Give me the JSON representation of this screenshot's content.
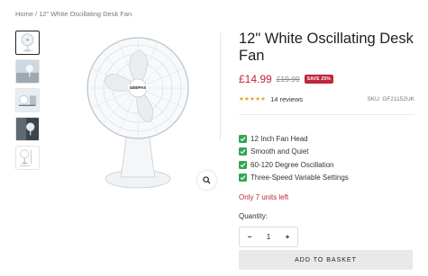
{
  "breadcrumb": {
    "home": "Home",
    "separator": "/",
    "current": "12\" White Oscillating Desk Fan"
  },
  "product": {
    "title": "12\" White Oscillating Desk Fan",
    "price": "£14.99",
    "compare_price": "£19.99",
    "save_badge": "SAVE 25%",
    "rating_stars": "★★★★★",
    "reviews": "14 reviews",
    "sku": "SKU: GF21152UK",
    "features": [
      "12 Inch Fan Head",
      "Smooth and Quiet",
      "60-120 Degree Oscillation",
      "Three-Speed Variable Settings"
    ],
    "stock_message": "Only 7 units left",
    "quantity_label": "Quantity:",
    "quantity": "1",
    "decrement": "−",
    "increment": "+",
    "add_to_basket": "ADD TO BASKET"
  },
  "colors": {
    "accent": "#c0263b",
    "check": "#2fa84f",
    "stars": "#e6a323",
    "button_bg": "#e9e9e9"
  },
  "brand_on_fan": "GEEPAS"
}
